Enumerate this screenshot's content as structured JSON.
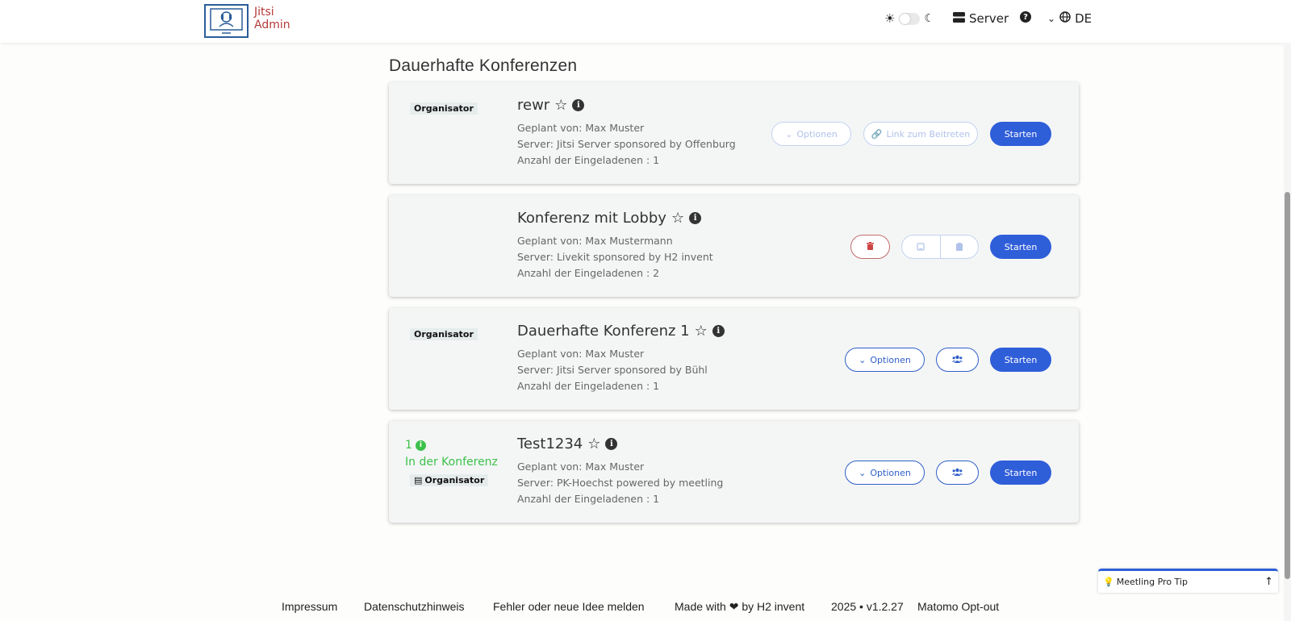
{
  "header": {
    "logo_line1": "Jitsi",
    "logo_line2": "Admin",
    "theme_light_icon": "sun-icon",
    "theme_dark_icon": "moon-icon",
    "server_label": "Server",
    "help_icon": "question-circle-icon",
    "language": "DE"
  },
  "page_title": "Dauerhafte Konferenzen",
  "cards": [
    {
      "badge": "Organisator",
      "title": "rewr",
      "planned_by": "Geplant von: Max Muster",
      "server": "Server: Jitsi Server sponsored by Offenburg",
      "invitees": "Anzahl der Eingeladenen : 1",
      "options_label": "Optionen",
      "link_label": "Link zum Beitreten",
      "start_label": "Starten"
    },
    {
      "title": "Konferenz mit Lobby",
      "planned_by": "Geplant von: Max Mustermann",
      "server": "Server: Livekit sponsored by H2 invent",
      "invitees": "Anzahl der Eingeladenen : 2",
      "start_label": "Starten"
    },
    {
      "badge": "Organisator",
      "title": "Dauerhafte Konferenz 1",
      "planned_by": "Geplant von: Max Muster",
      "server": "Server: Jitsi Server sponsored by Bühl",
      "invitees": "Anzahl der Eingeladenen : 1",
      "options_label": "Optionen",
      "start_label": "Starten"
    },
    {
      "active_count": "1",
      "active_label": "In der Konferenz",
      "badge": "Organisator",
      "title": "Test1234",
      "planned_by": "Geplant von: Max Muster",
      "server": "Server: PK-Hoechst powered by meetling",
      "invitees": "Anzahl der Eingeladenen : 1",
      "options_label": "Optionen",
      "start_label": "Starten"
    }
  ],
  "footer": {
    "impressum": "Impressum",
    "privacy": "Datenschutzhinweis",
    "feedback": "Fehler oder neue Idee melden",
    "made_with": "Made with ❤ by H2 invent",
    "version": "2025 • v1.2.27",
    "matomo": "Matomo Opt-out"
  },
  "protip": {
    "label": "Meetling Pro Tip"
  },
  "colors": {
    "accent": "#2f5ed9",
    "active_green": "#3cc14a",
    "logo_red": "#b53a3a"
  }
}
